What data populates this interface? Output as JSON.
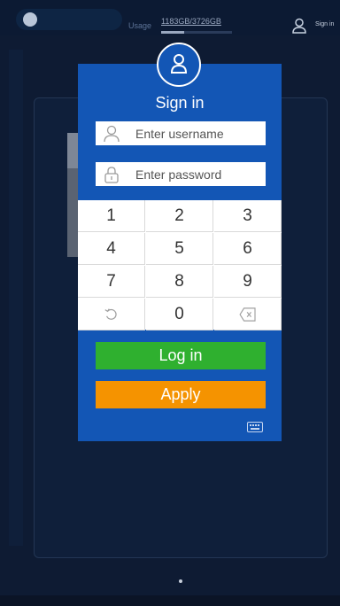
{
  "header": {
    "usage_label": "Usage",
    "usage_value": "1183GB/3726GB",
    "usage_fraction": 0.32,
    "signin_label": "Sign in"
  },
  "dialog": {
    "title": "Sign in",
    "username_placeholder": "Enter username",
    "password_placeholder": "Enter password",
    "keypad": [
      "1",
      "2",
      "3",
      "4",
      "5",
      "6",
      "7",
      "8",
      "9",
      "",
      "0",
      ""
    ],
    "login_label": "Log in",
    "apply_label": "Apply"
  },
  "colors": {
    "dialog_bg": "#1356b5",
    "login": "#2fb02f",
    "apply": "#f59300"
  },
  "icons": {
    "avatar": "user-icon",
    "username": "user-icon",
    "password": "lock-icon",
    "reset": "reset-icon",
    "backspace": "backspace-icon",
    "keyboard": "keyboard-icon"
  }
}
